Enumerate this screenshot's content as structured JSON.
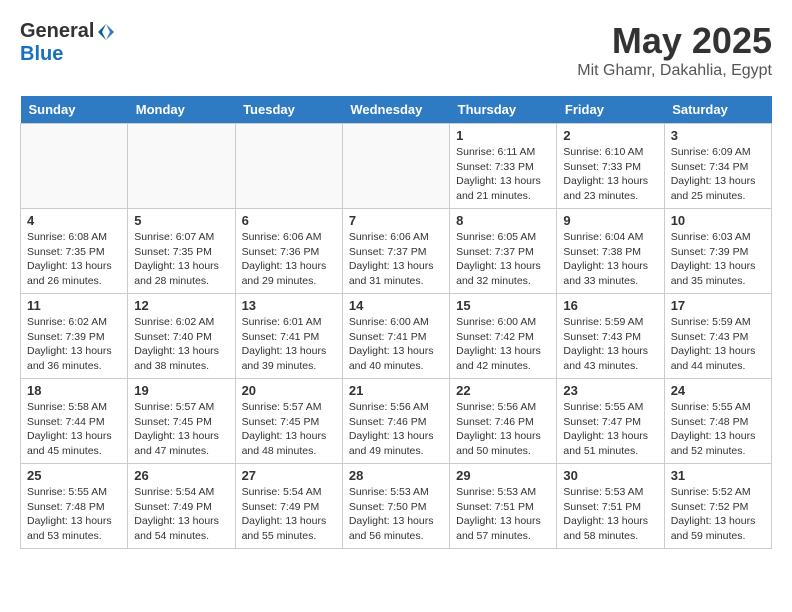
{
  "header": {
    "logo_general": "General",
    "logo_blue": "Blue",
    "month": "May 2025",
    "location": "Mit Ghamr, Dakahlia, Egypt"
  },
  "days_of_week": [
    "Sunday",
    "Monday",
    "Tuesday",
    "Wednesday",
    "Thursday",
    "Friday",
    "Saturday"
  ],
  "weeks": [
    [
      {
        "day": "",
        "info": ""
      },
      {
        "day": "",
        "info": ""
      },
      {
        "day": "",
        "info": ""
      },
      {
        "day": "",
        "info": ""
      },
      {
        "day": "1",
        "info": "Sunrise: 6:11 AM\nSunset: 7:33 PM\nDaylight: 13 hours\nand 21 minutes."
      },
      {
        "day": "2",
        "info": "Sunrise: 6:10 AM\nSunset: 7:33 PM\nDaylight: 13 hours\nand 23 minutes."
      },
      {
        "day": "3",
        "info": "Sunrise: 6:09 AM\nSunset: 7:34 PM\nDaylight: 13 hours\nand 25 minutes."
      }
    ],
    [
      {
        "day": "4",
        "info": "Sunrise: 6:08 AM\nSunset: 7:35 PM\nDaylight: 13 hours\nand 26 minutes."
      },
      {
        "day": "5",
        "info": "Sunrise: 6:07 AM\nSunset: 7:35 PM\nDaylight: 13 hours\nand 28 minutes."
      },
      {
        "day": "6",
        "info": "Sunrise: 6:06 AM\nSunset: 7:36 PM\nDaylight: 13 hours\nand 29 minutes."
      },
      {
        "day": "7",
        "info": "Sunrise: 6:06 AM\nSunset: 7:37 PM\nDaylight: 13 hours\nand 31 minutes."
      },
      {
        "day": "8",
        "info": "Sunrise: 6:05 AM\nSunset: 7:37 PM\nDaylight: 13 hours\nand 32 minutes."
      },
      {
        "day": "9",
        "info": "Sunrise: 6:04 AM\nSunset: 7:38 PM\nDaylight: 13 hours\nand 33 minutes."
      },
      {
        "day": "10",
        "info": "Sunrise: 6:03 AM\nSunset: 7:39 PM\nDaylight: 13 hours\nand 35 minutes."
      }
    ],
    [
      {
        "day": "11",
        "info": "Sunrise: 6:02 AM\nSunset: 7:39 PM\nDaylight: 13 hours\nand 36 minutes."
      },
      {
        "day": "12",
        "info": "Sunrise: 6:02 AM\nSunset: 7:40 PM\nDaylight: 13 hours\nand 38 minutes."
      },
      {
        "day": "13",
        "info": "Sunrise: 6:01 AM\nSunset: 7:41 PM\nDaylight: 13 hours\nand 39 minutes."
      },
      {
        "day": "14",
        "info": "Sunrise: 6:00 AM\nSunset: 7:41 PM\nDaylight: 13 hours\nand 40 minutes."
      },
      {
        "day": "15",
        "info": "Sunrise: 6:00 AM\nSunset: 7:42 PM\nDaylight: 13 hours\nand 42 minutes."
      },
      {
        "day": "16",
        "info": "Sunrise: 5:59 AM\nSunset: 7:43 PM\nDaylight: 13 hours\nand 43 minutes."
      },
      {
        "day": "17",
        "info": "Sunrise: 5:59 AM\nSunset: 7:43 PM\nDaylight: 13 hours\nand 44 minutes."
      }
    ],
    [
      {
        "day": "18",
        "info": "Sunrise: 5:58 AM\nSunset: 7:44 PM\nDaylight: 13 hours\nand 45 minutes."
      },
      {
        "day": "19",
        "info": "Sunrise: 5:57 AM\nSunset: 7:45 PM\nDaylight: 13 hours\nand 47 minutes."
      },
      {
        "day": "20",
        "info": "Sunrise: 5:57 AM\nSunset: 7:45 PM\nDaylight: 13 hours\nand 48 minutes."
      },
      {
        "day": "21",
        "info": "Sunrise: 5:56 AM\nSunset: 7:46 PM\nDaylight: 13 hours\nand 49 minutes."
      },
      {
        "day": "22",
        "info": "Sunrise: 5:56 AM\nSunset: 7:46 PM\nDaylight: 13 hours\nand 50 minutes."
      },
      {
        "day": "23",
        "info": "Sunrise: 5:55 AM\nSunset: 7:47 PM\nDaylight: 13 hours\nand 51 minutes."
      },
      {
        "day": "24",
        "info": "Sunrise: 5:55 AM\nSunset: 7:48 PM\nDaylight: 13 hours\nand 52 minutes."
      }
    ],
    [
      {
        "day": "25",
        "info": "Sunrise: 5:55 AM\nSunset: 7:48 PM\nDaylight: 13 hours\nand 53 minutes."
      },
      {
        "day": "26",
        "info": "Sunrise: 5:54 AM\nSunset: 7:49 PM\nDaylight: 13 hours\nand 54 minutes."
      },
      {
        "day": "27",
        "info": "Sunrise: 5:54 AM\nSunset: 7:49 PM\nDaylight: 13 hours\nand 55 minutes."
      },
      {
        "day": "28",
        "info": "Sunrise: 5:53 AM\nSunset: 7:50 PM\nDaylight: 13 hours\nand 56 minutes."
      },
      {
        "day": "29",
        "info": "Sunrise: 5:53 AM\nSunset: 7:51 PM\nDaylight: 13 hours\nand 57 minutes."
      },
      {
        "day": "30",
        "info": "Sunrise: 5:53 AM\nSunset: 7:51 PM\nDaylight: 13 hours\nand 58 minutes."
      },
      {
        "day": "31",
        "info": "Sunrise: 5:52 AM\nSunset: 7:52 PM\nDaylight: 13 hours\nand 59 minutes."
      }
    ]
  ]
}
